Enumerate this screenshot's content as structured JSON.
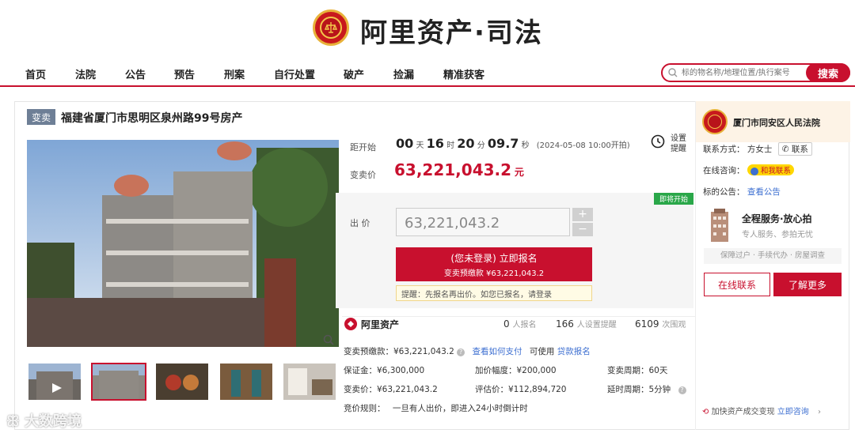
{
  "header": {
    "logo_text": "阿里资产·司法"
  },
  "nav": {
    "items": [
      "首页",
      "法院",
      "公告",
      "预告",
      "刑案",
      "自行处置",
      "破产",
      "捡漏",
      "精准获客"
    ]
  },
  "search": {
    "placeholder": "标的物名称/地理位置/执行案号",
    "button": "搜索"
  },
  "listing": {
    "tag": "变卖",
    "title": "福建省厦门市思明区泉州路99号房产"
  },
  "countdown": {
    "label": "距开始",
    "days": "00",
    "days_unit": "天",
    "hours": "16",
    "hours_unit": "时",
    "minutes": "20",
    "minutes_unit": "分",
    "seconds": "09.7",
    "seconds_unit": "秒",
    "start_time": "(2024-05-08 10:00开拍)",
    "reminder_line1": "设置",
    "reminder_line2": "提醒"
  },
  "price": {
    "label": "变卖价",
    "value": "63,221,043.2",
    "unit": "元"
  },
  "bid": {
    "badge": "即将开始",
    "label": "出 价",
    "input_value": "63,221,043.2",
    "plus": "+",
    "minus": "−",
    "register_line1": "(您未登录) 立即报名",
    "register_line2": "变卖预缴款 ¥63,221,043.2",
    "reminder": "提醒：先报名再出价。如您已报名，请登录"
  },
  "stats": {
    "brand": "阿里资产",
    "items": [
      {
        "num": "0",
        "label": "人报名"
      },
      {
        "num": "166",
        "label": "人设置提醒"
      },
      {
        "num": "6109",
        "label": "次围观"
      }
    ]
  },
  "details": {
    "deposit_label": "变卖预缴款：¥63,221,043.2",
    "pay_link": "查看如何支付",
    "can_use": "可使用",
    "loan_link": "贷款报名",
    "margin": "保证金：¥6,300,000",
    "increment": "加价幅度：¥200,000",
    "period": "变卖周期：60天",
    "sale_price": "变卖价：¥63,221,043.2",
    "appraisal": "评估价：¥112,894,720",
    "delay": "延时周期：5分钟",
    "rule_label": "竞价规则：",
    "rule_text": "一旦有人出价，即进入24小时倒计时"
  },
  "court": {
    "name": "厦门市同安区人民法院",
    "contact_label": "联系方式：",
    "contact_name": "方女士",
    "contact_btn": "联系",
    "consult_label": "在线咨询：",
    "consult_btn": "和我联系",
    "notice_label": "标的公告：",
    "notice_link": "查看公告",
    "promo_title": "全程服务·放心拍",
    "promo_sub": "专人服务、参拍无忧",
    "services": "保障过户 · 手续代办 · 房屋调查",
    "btn_contact": "在线联系",
    "btn_more": "了解更多",
    "footer_text": "加快资产成交变现",
    "footer_link": "立即咨询"
  },
  "watermark": {
    "text": "大数跨境"
  },
  "colors": {
    "brand_red": "#c8102e",
    "link_blue": "#3d6fd1",
    "green_badge": "#2aa749"
  }
}
